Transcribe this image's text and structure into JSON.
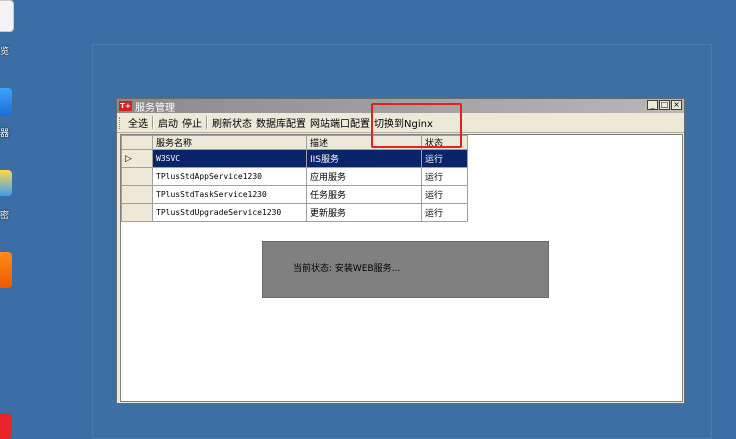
{
  "desktop": {
    "icons": [
      {
        "label": "览",
        "icon": "document-icon"
      },
      {
        "label": "器",
        "icon": "browser-icon"
      },
      {
        "label": "密",
        "icon": "lock-icon"
      },
      {
        "label": "",
        "icon": "app-icon"
      },
      {
        "label": "",
        "icon": "app-icon"
      }
    ]
  },
  "window": {
    "logo": "T+",
    "title": "服务管理",
    "controls": {
      "minimize": "_",
      "maximize": "□",
      "close": "×"
    }
  },
  "toolbar": {
    "select_all": "全选",
    "start": "启动",
    "stop": "停止",
    "refresh": "刷新状态",
    "db_config": "数据库配置",
    "port_config": "网站端口配置",
    "switch_nginx": "切换到Nginx"
  },
  "table": {
    "headers": [
      "服务名称",
      "描述",
      "状态"
    ],
    "rows": [
      {
        "indicator": "▷",
        "name": "W3SVC",
        "desc": "IIS服务",
        "status": "运行"
      },
      {
        "indicator": "",
        "name": "TPlusStdAppService1230",
        "desc": "应用服务",
        "status": "运行"
      },
      {
        "indicator": "",
        "name": "TPlusStdTaskService1230",
        "desc": "任务服务",
        "status": "运行"
      },
      {
        "indicator": "",
        "name": "TPlusStdUpgradeService1230",
        "desc": "更新服务",
        "status": "运行"
      }
    ]
  },
  "status_panel": {
    "text": "当前状态: 安装WEB服务..."
  },
  "colors": {
    "desktop": "#3a6ea5",
    "selection": "#0a246a",
    "highlight": "#e62020"
  }
}
